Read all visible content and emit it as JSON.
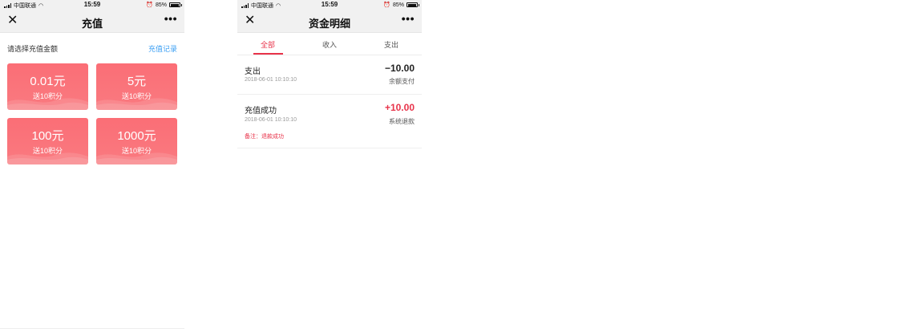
{
  "status_bar": {
    "carrier": "中国联通",
    "time": "15:59",
    "battery": "85%",
    "battery_level": 0.85
  },
  "recharge_page": {
    "title": "充值",
    "prompt": "请选择充值金额",
    "record_link": "充值记录",
    "options": [
      {
        "amount": "0.01元",
        "bonus": "送10积分"
      },
      {
        "amount": "5元",
        "bonus": "送10积分"
      },
      {
        "amount": "100元",
        "bonus": "送10积分"
      },
      {
        "amount": "1000元",
        "bonus": "送10积分"
      }
    ],
    "card_color": "#f97078"
  },
  "detail_page": {
    "title": "资金明细",
    "tabs": [
      "全部",
      "收入",
      "支出"
    ],
    "active_tab": "全部",
    "accent_color": "#e8334a",
    "transactions": [
      {
        "title": "支出",
        "date": "2018-06-01 10:10:10",
        "amount": "−10.00",
        "method": "余额支付",
        "note": ""
      },
      {
        "title": "充值成功",
        "date": "2018-06-01 10:10:10",
        "amount": "+10.00",
        "method": "系统退款",
        "note": "备注：退款成功"
      }
    ]
  }
}
